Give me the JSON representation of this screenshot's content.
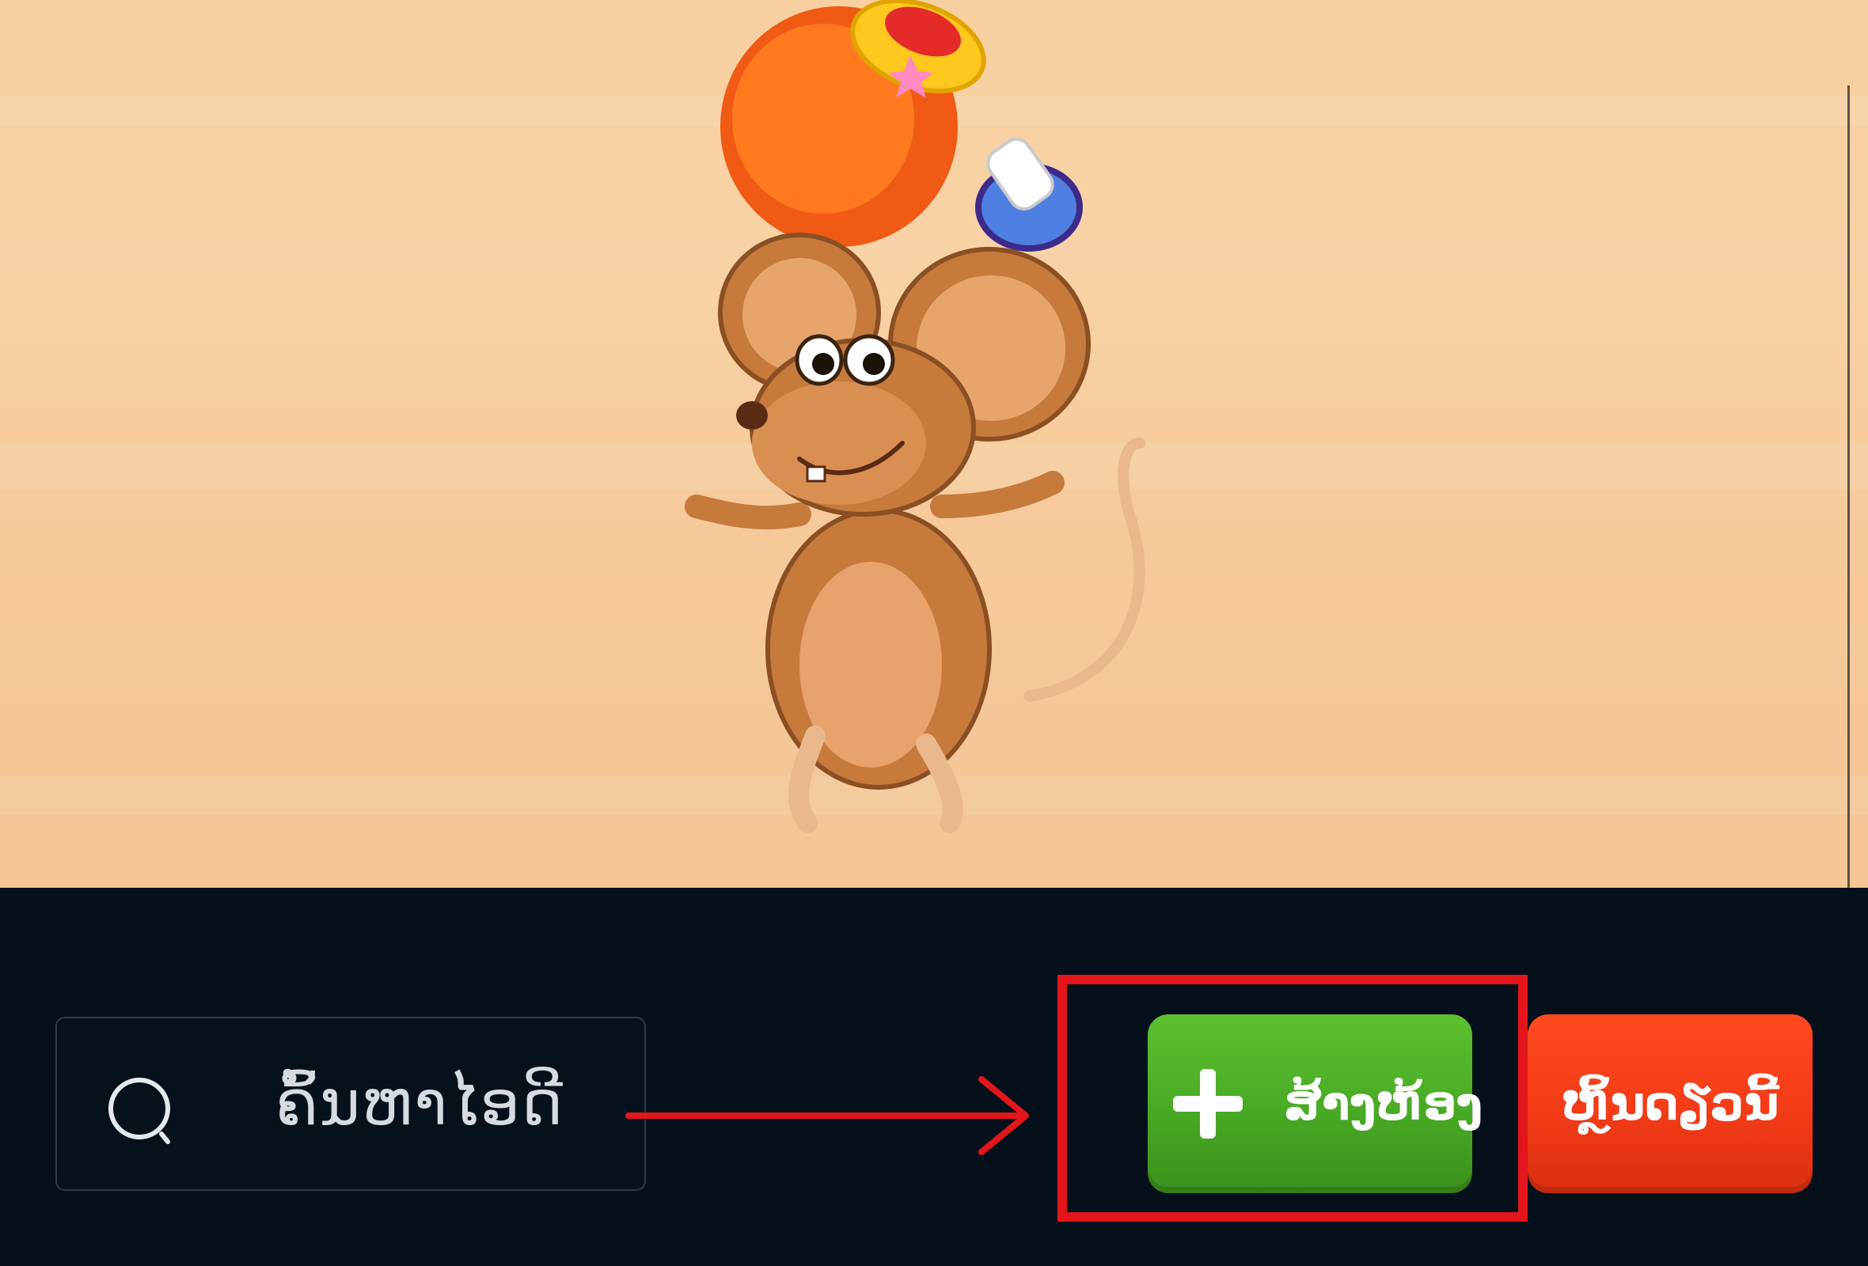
{
  "search": {
    "placeholder": "ຄົ້ນຫາໄອດີ"
  },
  "actions": {
    "create_room_label": "ສ້າງຫ້ອງ",
    "play_now_label": "ຫຼິ້ນດຽວນີ້"
  },
  "icons": {
    "search": "search-icon",
    "plus": "plus-icon",
    "mascot": "mouse-mascot-icon",
    "hammer": "toy-hammer-icon"
  },
  "colors": {
    "game_background": "#f7cfa0",
    "bottom_bar": "#06101b",
    "create_button": "#4caf27",
    "play_button": "#f33b17",
    "highlight": "#e3161b"
  }
}
